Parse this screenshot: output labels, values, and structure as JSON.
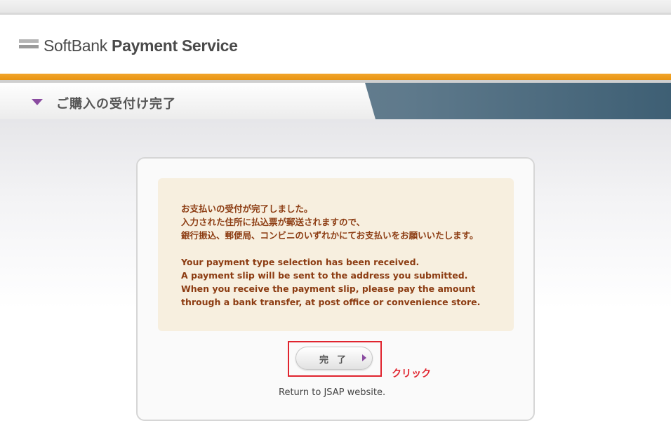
{
  "header": {
    "logo_part1": "SoftBank",
    "logo_part2": "Payment Service"
  },
  "page": {
    "title": "ご購入の受付け完了"
  },
  "notice": {
    "lines": [
      "お支払いの受付が完了しました。",
      "入力された住所に払込票が郵送されますので、",
      "銀行振込、郵便局、コンビニのいずれかにてお支払いをお願いいたします。",
      "Your payment type selection has been received.",
      "A payment slip will be sent to the address you submitted.",
      "When you receive the payment slip, please pay the amount",
      "through a bank transfer, at post office or convenience store."
    ]
  },
  "actions": {
    "done_label": "完了",
    "annotation": "クリック",
    "return_text": "Return to JSAP website."
  },
  "colors": {
    "accent_orange": "#f2a52a",
    "notice_text": "#8c3c12",
    "notice_bg": "#f7efdf",
    "highlight_red": "#e0242e",
    "marker_purple": "#8a4ba0"
  }
}
